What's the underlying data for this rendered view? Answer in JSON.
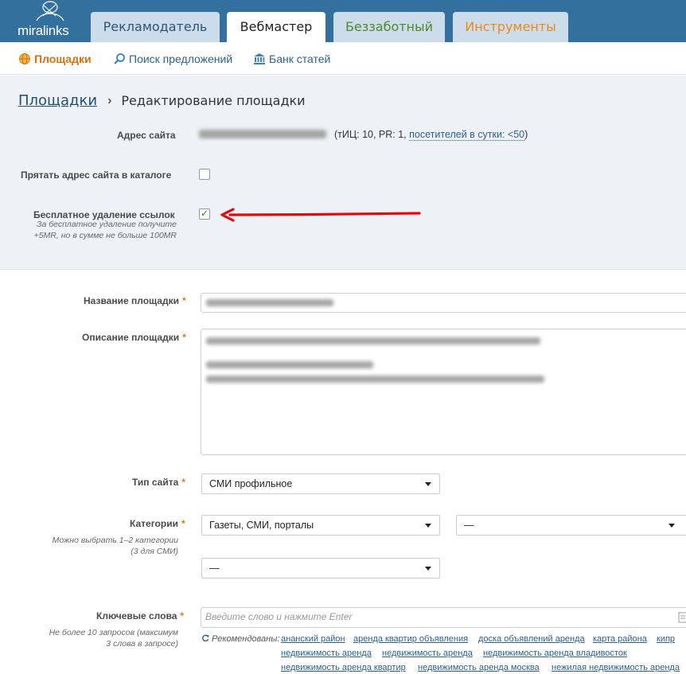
{
  "header": {
    "logo_text": "miralinks",
    "tabs": [
      {
        "label": "Рекламодатель"
      },
      {
        "label": "Вебмастер"
      },
      {
        "label": "Беззаботный"
      },
      {
        "label": "Инструменты"
      }
    ]
  },
  "subnav": {
    "items": [
      {
        "label": "Площадки",
        "icon": "globe-icon"
      },
      {
        "label": "Поиск предложений",
        "icon": "magnifier-icon"
      },
      {
        "label": "Банк статей",
        "icon": "bank-icon"
      }
    ]
  },
  "breadcrumb": {
    "link": "Площадки",
    "separator": "›",
    "current": "Редактирование площадки"
  },
  "site": {
    "address_label": "Адрес сайта",
    "info_prefix": "(тИЦ: 10, PR: 1,",
    "visitors_link": "посетителей в сутки: <50",
    "info_suffix": ")"
  },
  "hide": {
    "label": "Прятать адрес сайта в каталоге",
    "checked": false
  },
  "free_removal": {
    "label": "Бесплатное удаление ссылок",
    "hint": "За бесплатное удаление получите +5MR, но в сумме не больше 100MR",
    "checked": true,
    "arrow_color": "#e10a0a"
  },
  "form": {
    "required_mark": "*",
    "name_label": "Название площадки",
    "description_label": "Описание площадки",
    "type_label": "Тип сайта",
    "type_value": "СМИ профильное",
    "categories_label": "Категории",
    "categories_hint": "Можно выбрать 1–2 категории (3 для СМИ)",
    "category_1": "Газеты, СМИ, порталы",
    "category_2": "—",
    "category_3": "—",
    "keywords_label": "Ключевые слова",
    "keywords_hint": "Не более 10 запросов (максимум 3 слова в запросе)",
    "keywords_placeholder": "Введите слово и нажмите Enter",
    "recommended_label": "Рекомендованы:",
    "recommended": [
      "ананский район",
      "аренда квартир объявления",
      "доска объявлений аренда",
      "карта района",
      "кипр",
      "недвижимость аренда",
      "недвижимость аренда",
      "недвижимость аренда владивосток",
      "недвижимость аренда квартир",
      "недвижимость аренда москва",
      "нежилая недвижимость аренда"
    ]
  },
  "colors": {
    "header_bg": "#33709e",
    "accent_orange": "#e06d0c",
    "link_blue": "#2c5e8f",
    "gray_panel": "#eef1f5"
  }
}
